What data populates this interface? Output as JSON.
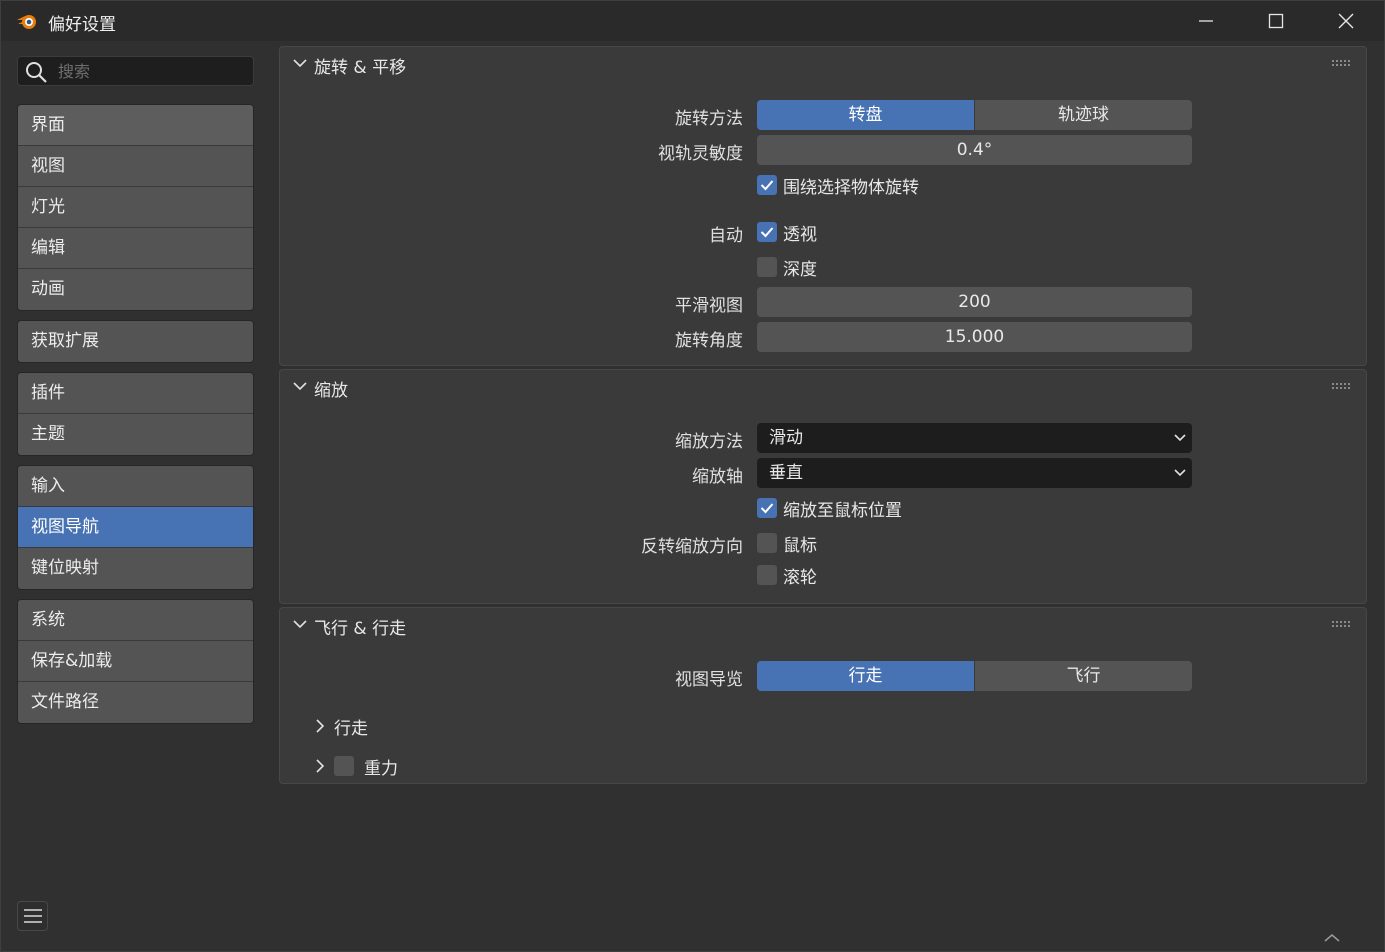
{
  "window": {
    "title": "偏好设置"
  },
  "search": {
    "placeholder": "搜索",
    "value": ""
  },
  "sidebar": {
    "groups": [
      [
        "界面",
        "视图",
        "灯光",
        "编辑",
        "动画"
      ],
      [
        "获取扩展"
      ],
      [
        "插件",
        "主题"
      ],
      [
        "输入",
        "视图导航",
        "键位映射"
      ],
      [
        "系统",
        "保存&加载",
        "文件路径"
      ]
    ],
    "active": "视图导航"
  },
  "orbit_pan": {
    "title": "旋转 & 平移",
    "orbit_method_label": "旋转方法",
    "orbit_method_options": [
      "转盘",
      "轨迹球"
    ],
    "orbit_method_selected": "转盘",
    "orbit_sensitivity_label": "视轨灵敏度",
    "orbit_sensitivity_value": "0.4°",
    "orbit_around_selection_label": "围绕选择物体旋转",
    "orbit_around_selection": true,
    "auto_label": "自动",
    "auto_perspective_label": "透视",
    "auto_perspective": true,
    "auto_depth_label": "深度",
    "auto_depth": false,
    "smooth_view_label": "平滑视图",
    "smooth_view_value": "200",
    "rotation_angle_label": "旋转角度",
    "rotation_angle_value": "15.000"
  },
  "zoom": {
    "title": "缩放",
    "zoom_method_label": "缩放方法",
    "zoom_method_value": "滑动",
    "zoom_axis_label": "缩放轴",
    "zoom_axis_value": "垂直",
    "zoom_to_mouse_label": "缩放至鼠标位置",
    "zoom_to_mouse": true,
    "invert_label": "反转缩放方向",
    "invert_mouse_label": "鼠标",
    "invert_mouse": false,
    "invert_wheel_label": "滚轮",
    "invert_wheel": false
  },
  "fly_walk": {
    "title": "飞行 & 行走",
    "navigation_label": "视图导览",
    "navigation_options": [
      "行走",
      "飞行"
    ],
    "navigation_selected": "行走",
    "walk_label": "行走",
    "gravity_label": "重力",
    "gravity": false
  },
  "colors": {
    "accent": "#4772b3",
    "button": "#545454",
    "panel": "#3a3a3a",
    "background": "#303030"
  }
}
